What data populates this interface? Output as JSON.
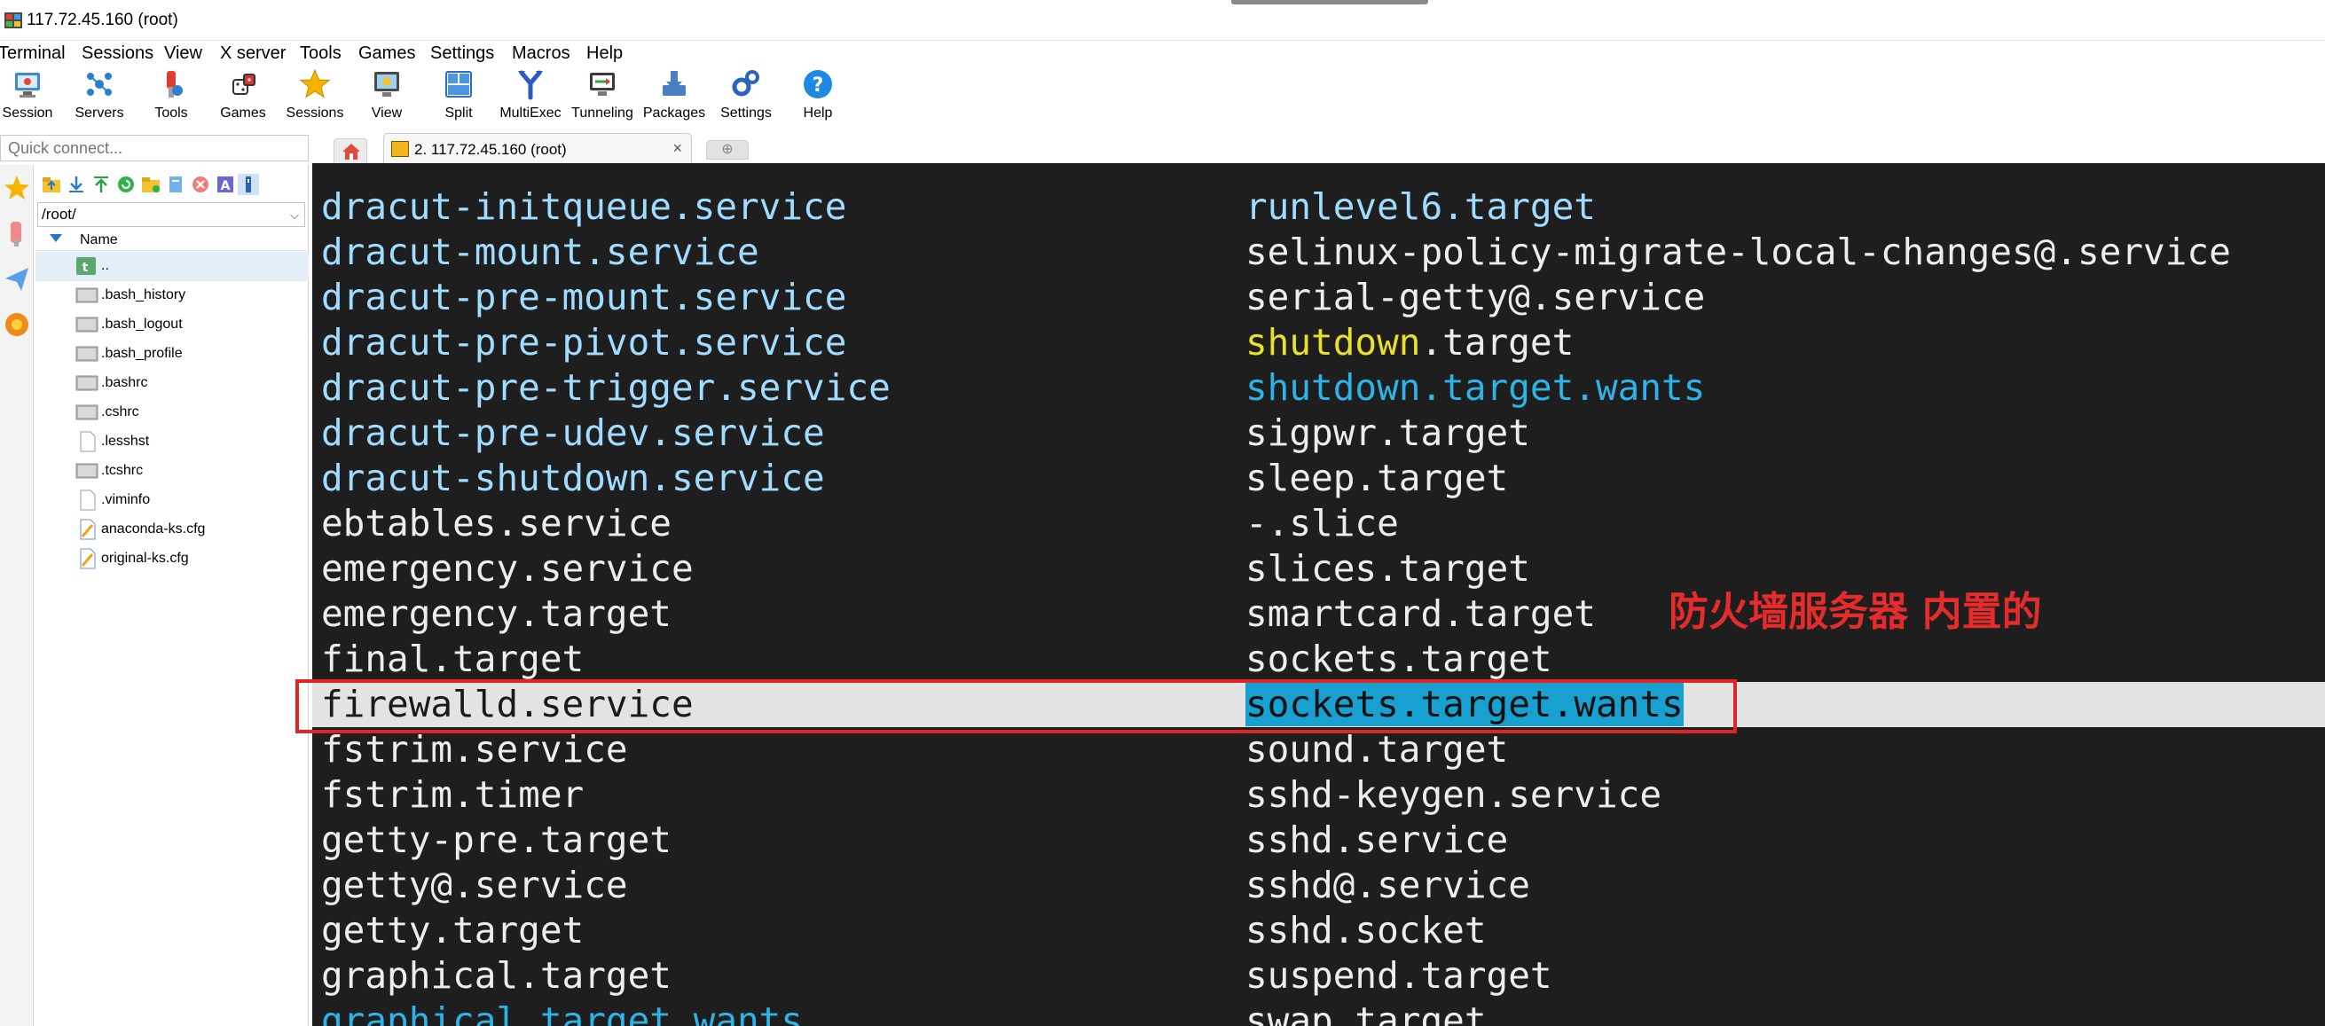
{
  "window": {
    "title": "117.72.45.160 (root)"
  },
  "menu": [
    "Terminal",
    "Sessions",
    "View",
    "X server",
    "Tools",
    "Games",
    "Settings",
    "Macros",
    "Help"
  ],
  "toolbar": [
    {
      "label": "Session",
      "icon": "session-icon"
    },
    {
      "label": "Servers",
      "icon": "servers-icon"
    },
    {
      "label": "Tools",
      "icon": "tools-icon"
    },
    {
      "label": "Games",
      "icon": "games-icon"
    },
    {
      "label": "Sessions",
      "icon": "star-icon"
    },
    {
      "label": "View",
      "icon": "view-icon"
    },
    {
      "label": "Split",
      "icon": "split-icon"
    },
    {
      "label": "MultiExec",
      "icon": "multiexec-icon"
    },
    {
      "label": "Tunneling",
      "icon": "tunneling-icon"
    },
    {
      "label": "Packages",
      "icon": "packages-icon"
    },
    {
      "label": "Settings",
      "icon": "settings-icon"
    },
    {
      "label": "Help",
      "icon": "help-icon"
    }
  ],
  "quick_connect": {
    "placeholder": "Quick connect..."
  },
  "sftp": {
    "path": "/root/",
    "column_header": "Name",
    "files": [
      {
        "name": "..",
        "type": "parent"
      },
      {
        "name": ".bash_history",
        "type": "file"
      },
      {
        "name": ".bash_logout",
        "type": "file"
      },
      {
        "name": ".bash_profile",
        "type": "file"
      },
      {
        "name": ".bashrc",
        "type": "file"
      },
      {
        "name": ".cshrc",
        "type": "file"
      },
      {
        "name": ".lesshst",
        "type": "doc"
      },
      {
        "name": ".tcshrc",
        "type": "file"
      },
      {
        "name": ".viminfo",
        "type": "doc"
      },
      {
        "name": "anaconda-ks.cfg",
        "type": "cfg"
      },
      {
        "name": "original-ks.cfg",
        "type": "cfg"
      }
    ]
  },
  "tabs": {
    "session_label": "2. 117.72.45.160 (root)",
    "close_glyph": "×",
    "new_tab_glyph": "⊕"
  },
  "terminal": {
    "lines": [
      {
        "left": "dracut-initqueue.service",
        "right": "runlevel6.target"
      },
      {
        "left": "dracut-mount.service",
        "right": "selinux-policy-migrate-local-changes@.service"
      },
      {
        "left": "dracut-pre-mount.service",
        "right": "serial-getty@.service"
      },
      {
        "left": "dracut-pre-pivot.service",
        "right": "shutdown",
        "right_suffix": ".target"
      },
      {
        "left": "dracut-pre-trigger.service",
        "right": "shutdown.target.wants"
      },
      {
        "left": "dracut-pre-udev.service",
        "right": "sigpwr.target"
      },
      {
        "left": "dracut-shutdown.service",
        "right": "sleep.target"
      },
      {
        "left": "ebtables.service",
        "right": "-.slice"
      },
      {
        "left": "emergency.service",
        "right": "slices.target"
      },
      {
        "left": "emergency.target",
        "right": "smartcard.target"
      },
      {
        "left": "final.target",
        "right": "sockets.target"
      },
      {
        "left": "firewalld.service",
        "right": "sockets.target.wants"
      },
      {
        "left": "fstrim.service",
        "right": "sound.target"
      },
      {
        "left": "fstrim.timer",
        "right": "sshd-keygen.service"
      },
      {
        "left": "getty-pre.target",
        "right": "sshd.service"
      },
      {
        "left": "getty@.service",
        "right": "sshd@.service"
      },
      {
        "left": "getty.target",
        "right": "sshd.socket"
      },
      {
        "left": "graphical.target",
        "right": "suspend.target"
      },
      {
        "left": "graphical.target.wants",
        "right": "swap.target"
      }
    ],
    "annotation": "防火墙服务器  内置的"
  },
  "colors": {
    "terminal_bg": "#1e1e1e",
    "service_text": "#9fdcff",
    "plain_text": "#ededed",
    "directory_text": "#2fb3e6",
    "highlight_text": "#e8e02a",
    "annotation": "#e42c2c"
  }
}
